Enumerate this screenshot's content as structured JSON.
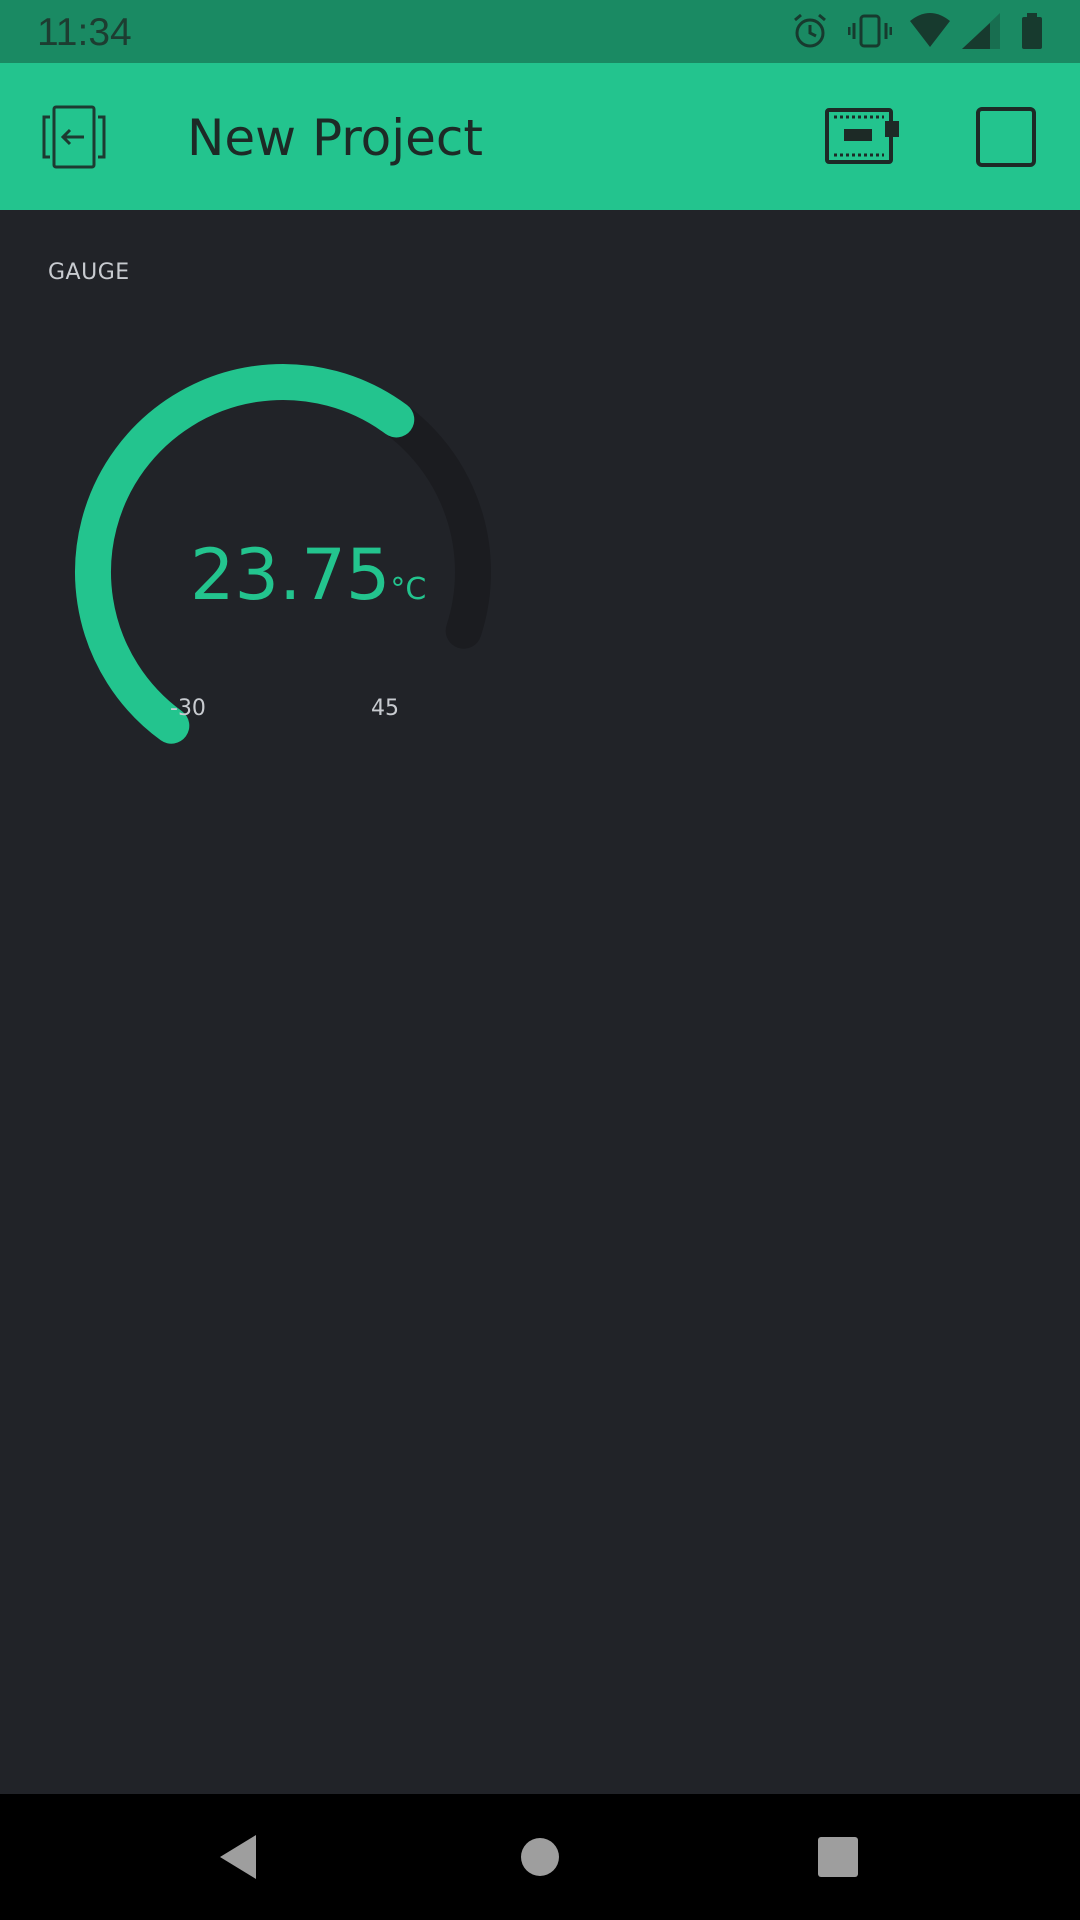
{
  "status_bar": {
    "time": "11:34",
    "icons": [
      "alarm-icon",
      "vibrate-icon",
      "wifi-icon",
      "signal-icon",
      "battery-icon"
    ]
  },
  "app_bar": {
    "title": "New Project",
    "back_icon": "exit-project-icon",
    "device_icon": "device-board-icon",
    "play_icon": "play-square-icon",
    "color_background": "#23c48e",
    "color_text": "#1d2a26"
  },
  "widget": {
    "title": "GAUGE",
    "value": "23.75",
    "value_number": 23.75,
    "unit": "°C",
    "min": "-30",
    "max": "45",
    "min_value": -30,
    "max_value": 45,
    "color_accent": "#23c48e",
    "color_track": "#1b1c20"
  },
  "nav_bar": {
    "icons": [
      "back-triangle-icon",
      "home-circle-icon",
      "recents-square-icon"
    ]
  }
}
